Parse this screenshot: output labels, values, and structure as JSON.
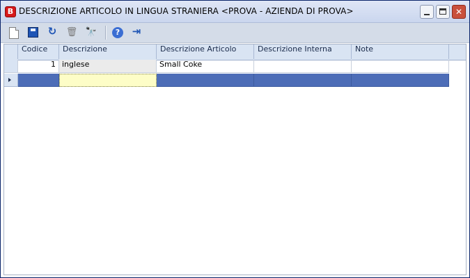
{
  "window": {
    "title": "DESCRIZIONE ARTICOLO IN LINGUA STRANIERA <PROVA - AZIENDA DI PROVA>",
    "app_icon_letter": "B"
  },
  "toolbar": {
    "buttons": [
      "new-document-icon",
      "save-icon",
      "undo-icon",
      "delete-icon",
      "find-icon",
      "help-icon",
      "exit-icon"
    ],
    "undo_glyph": "↻",
    "delete_glyph": "🗑",
    "find_glyph": "🔭",
    "help_glyph": "?",
    "exit_glyph": "⇥"
  },
  "grid": {
    "columns": [
      "Codice",
      "Descrizione",
      "Descrizione Articolo",
      "Descrizione Interna",
      "Note"
    ],
    "rows": [
      {
        "codice": "1",
        "descrizione": "inglese",
        "descrizione_articolo": "Small Coke",
        "descrizione_interna": "",
        "note": ""
      },
      {
        "codice": "",
        "descrizione": "",
        "descrizione_articolo": "",
        "descrizione_interna": "",
        "note": ""
      }
    ],
    "selected_row": 1
  },
  "colors": {
    "selection": "#4d6db7",
    "edit_cell": "#fdfdc7",
    "header": "#d9e4f3",
    "close_button": "#c9503c"
  }
}
